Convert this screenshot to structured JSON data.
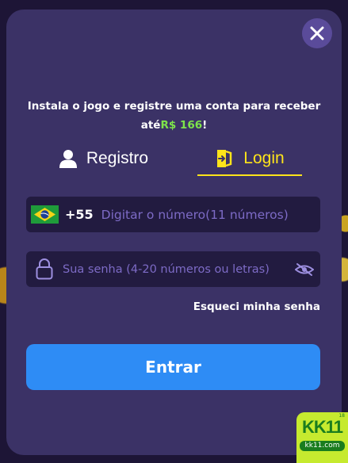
{
  "intro": {
    "text_before": "Instala o jogo e registre uma conta para receber até",
    "amount": "R$ 166",
    "text_after": "!"
  },
  "tabs": [
    {
      "label": "Registro",
      "icon": "user-icon",
      "active": false
    },
    {
      "label": "Login",
      "icon": "login-door-icon",
      "active": true
    }
  ],
  "phone": {
    "country_flag": "brazil-flag-icon",
    "country_code": "+55",
    "placeholder": "Digitar o número(11 números)",
    "value": ""
  },
  "password": {
    "placeholder": "Sua senha (4-20 números ou letras)",
    "value": ""
  },
  "forgot_label": "Esqueci minha senha",
  "submit_label": "Entrar",
  "logo": {
    "mark": "KK11",
    "domain": "kk11.com",
    "badge": "18"
  },
  "colors": {
    "modal_bg": "#3b3266",
    "field_bg": "#221b40",
    "active_tab": "#ffe41a",
    "amount": "#7ee34b",
    "button": "#2e8cf5"
  }
}
